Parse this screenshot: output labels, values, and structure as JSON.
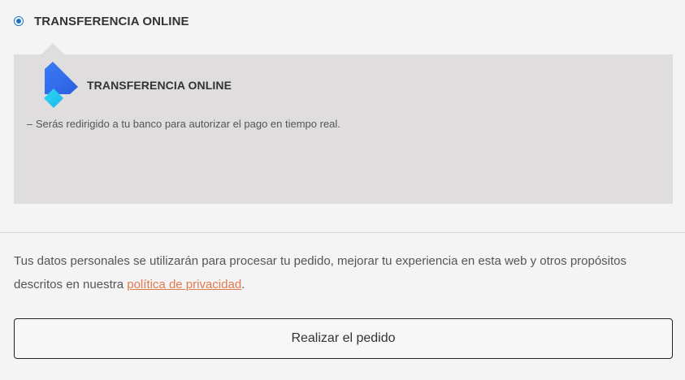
{
  "payment_method": {
    "selected": true,
    "label": "TRANSFERENCIA ONLINE"
  },
  "payment_box": {
    "logo_icon": "transferencia-logo-icon",
    "title": "TRANSFERENCIA ONLINE",
    "description": "– Serás redirigido a tu banco para autorizar el pago en tiempo real."
  },
  "privacy": {
    "text_before": "Tus datos personales se utilizarán para procesar tu pedido, mejorar tu experiencia en esta web y otros propósitos descritos en nuestra ",
    "link_text": "política de privacidad",
    "text_after": "."
  },
  "order_button": {
    "label": "Realizar el pedido"
  },
  "colors": {
    "accent": "#1a73c9",
    "link": "#e07a4f",
    "box_background": "#dfdddd",
    "page_background": "#f4f4f4"
  }
}
